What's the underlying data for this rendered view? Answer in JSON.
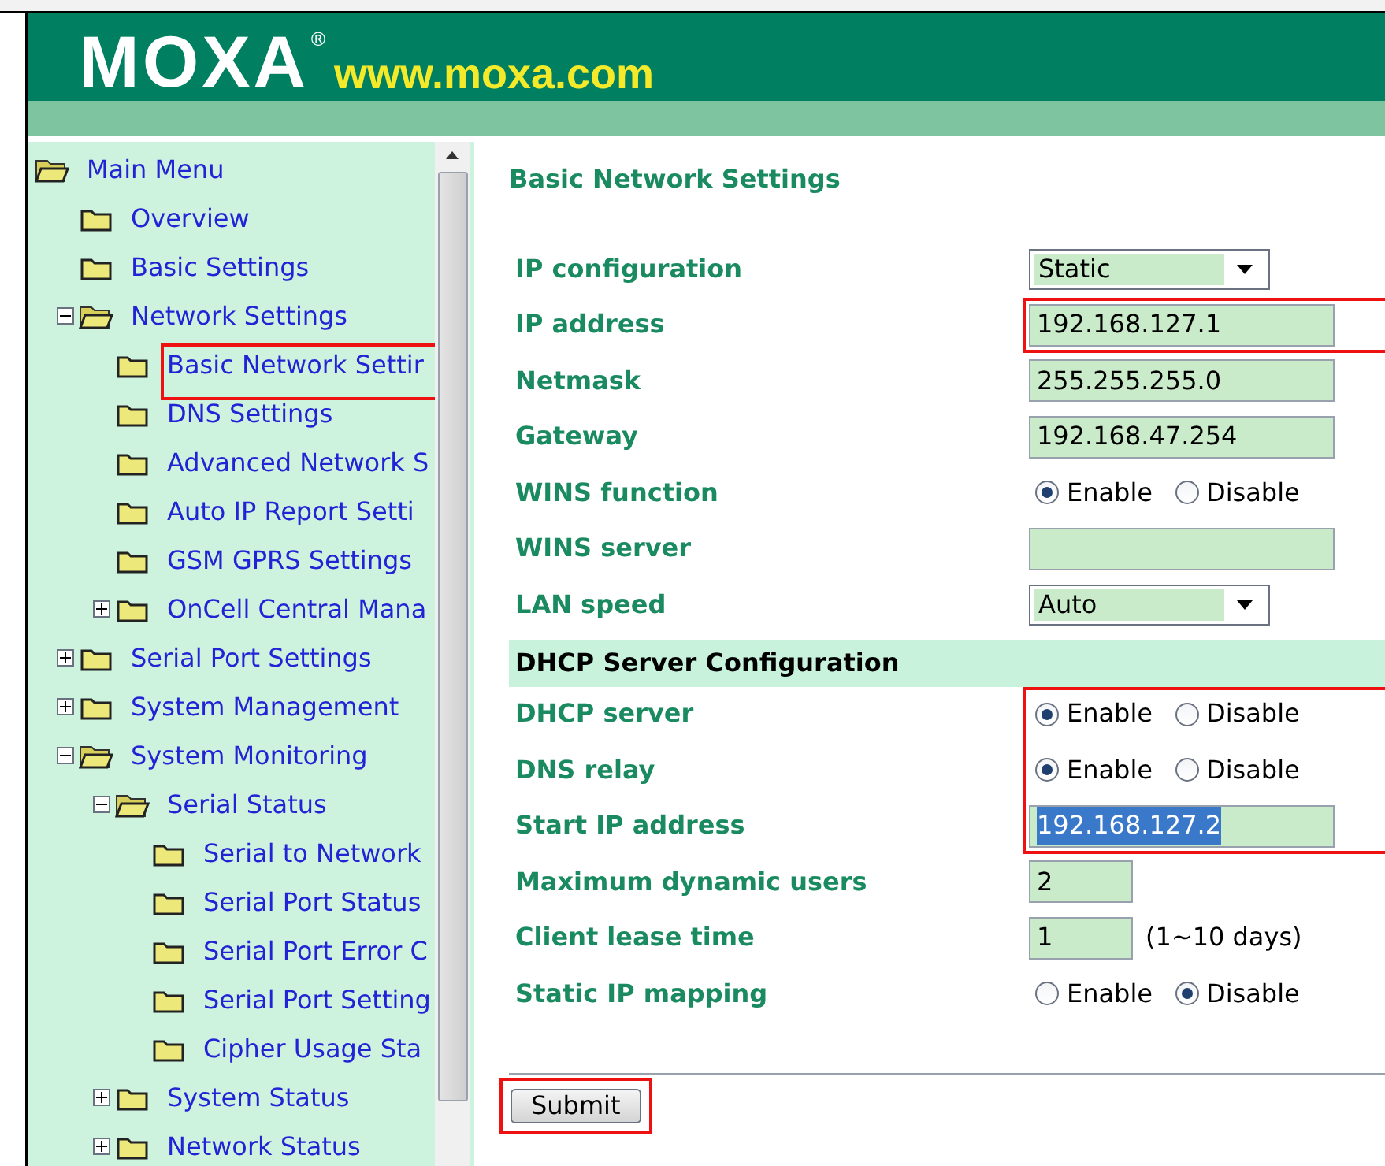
{
  "header": {
    "logo": "MOXA",
    "registered": "®",
    "url": "www.moxa.com"
  },
  "tree": [
    {
      "label": "Main Menu",
      "expanded": true,
      "highlighted": false,
      "children": [
        {
          "label": "Overview",
          "highlighted": false
        },
        {
          "label": "Basic Settings",
          "highlighted": false
        },
        {
          "label": "Network Settings",
          "expanded": true,
          "highlighted": false,
          "children": [
            {
              "label": "Basic Network Settir",
              "highlighted": true
            },
            {
              "label": "DNS Settings",
              "highlighted": false
            },
            {
              "label": "Advanced Network S",
              "highlighted": false
            },
            {
              "label": "Auto IP Report Setti",
              "highlighted": false
            },
            {
              "label": "GSM GPRS Settings",
              "highlighted": false
            },
            {
              "label": "OnCell Central Mana",
              "expanded": false,
              "highlighted": false
            }
          ]
        },
        {
          "label": "Serial Port Settings",
          "expanded": false,
          "highlighted": false
        },
        {
          "label": "System Management",
          "expanded": false,
          "highlighted": false
        },
        {
          "label": "System Monitoring",
          "expanded": true,
          "highlighted": false,
          "children": [
            {
              "label": "Serial Status",
              "expanded": true,
              "highlighted": false,
              "children": [
                {
                  "label": "Serial to Network",
                  "highlighted": false
                },
                {
                  "label": "Serial Port Status",
                  "highlighted": false
                },
                {
                  "label": "Serial Port Error C",
                  "highlighted": false
                },
                {
                  "label": "Serial Port Setting",
                  "highlighted": false
                },
                {
                  "label": "Cipher Usage Sta",
                  "highlighted": false
                }
              ]
            },
            {
              "label": "System Status",
              "expanded": false,
              "highlighted": false
            },
            {
              "label": "Network Status",
              "expanded": false,
              "highlighted": false
            }
          ]
        }
      ]
    }
  ],
  "page_title": "Basic Network Settings",
  "sections": [
    {
      "rows": [
        {
          "kind": "select",
          "label": "IP configuration",
          "value": "Static",
          "highlighted": false
        },
        {
          "kind": "text",
          "label": "IP address",
          "value": "192.168.127.1",
          "highlighted": true
        },
        {
          "kind": "text",
          "label": "Netmask",
          "value": "255.255.255.0",
          "highlighted": false
        },
        {
          "kind": "text",
          "label": "Gateway",
          "value": "192.168.47.254",
          "highlighted": false
        },
        {
          "kind": "radio",
          "label": "WINS function",
          "options": [
            {
              "label": "Enable",
              "selected": true
            },
            {
              "label": "Disable",
              "selected": false
            }
          ],
          "highlighted": false
        },
        {
          "kind": "text",
          "label": "WINS server",
          "highlighted": false
        },
        {
          "kind": "select",
          "label": "LAN speed",
          "value": "Auto",
          "highlighted": false
        }
      ]
    },
    {
      "title": "DHCP Server Configuration",
      "rows": [
        {
          "kind": "radio",
          "label": "DHCP server",
          "options": [
            {
              "label": "Enable",
              "selected": true
            },
            {
              "label": "Disable",
              "selected": false
            }
          ],
          "highlighted": true
        },
        {
          "kind": "radio",
          "label": "DNS relay",
          "options": [
            {
              "label": "Enable",
              "selected": true
            },
            {
              "label": "Disable",
              "selected": false
            }
          ],
          "highlighted": true
        },
        {
          "kind": "text",
          "label": "Start IP address",
          "value": "192.168.127.2",
          "text_selected": true,
          "highlighted": true
        },
        {
          "kind": "number",
          "label": "Maximum dynamic users",
          "value": "2",
          "highlighted": false
        },
        {
          "kind": "number",
          "label": "Client lease time",
          "value": "1",
          "note": "(1~10 days)",
          "highlighted": false
        },
        {
          "kind": "radio",
          "label": "Static IP mapping",
          "options": [
            {
              "label": "Enable",
              "selected": false
            },
            {
              "label": "Disable",
              "selected": true
            }
          ],
          "highlighted": false
        }
      ]
    }
  ],
  "submit": {
    "label": "Submit",
    "highlighted": true
  }
}
